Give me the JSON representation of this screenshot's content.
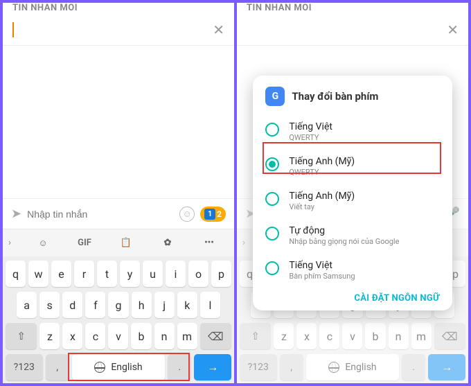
{
  "header": {
    "title": "TIN NHAN MOI"
  },
  "search": {
    "clear_glyph": "✕"
  },
  "compose": {
    "placeholder": "Nhập tin nhắn",
    "sim_number": "1",
    "sim_extra": "2"
  },
  "toolbar": {
    "arrow": "›",
    "sticker": "☺",
    "gif": "GIF",
    "clipboard": "📋",
    "settings": "✿",
    "more": "•••"
  },
  "keys": {
    "row1": [
      "q",
      "w",
      "e",
      "r",
      "t",
      "y",
      "u",
      "i",
      "o",
      "p"
    ],
    "row2": [
      "a",
      "s",
      "d",
      "f",
      "g",
      "h",
      "j",
      "k",
      "l"
    ],
    "row3": [
      "z",
      "x",
      "c",
      "v",
      "b",
      "n",
      "m"
    ],
    "shift": "⇧",
    "backspace": "⌫",
    "numswitch": "?123",
    "comma": ",",
    "period": ".",
    "enter": "→",
    "language": "English"
  },
  "popup": {
    "title": "Thay đổi bàn phím",
    "options": [
      {
        "label": "Tiếng Việt",
        "sub": "QWERTY",
        "selected": false
      },
      {
        "label": "Tiếng Anh (Mỹ)",
        "sub": "QWERTY",
        "selected": true
      },
      {
        "label": "Tiếng Anh (Mỹ)",
        "sub": "Viết tay",
        "selected": false
      },
      {
        "label": "Tự động",
        "sub": "Nhập bằng giọng nói của Google",
        "selected": false
      },
      {
        "label": "Tiếng Việt",
        "sub": "Bàn phím Samsung",
        "selected": false
      }
    ],
    "footer": "CÀI ĐẶT NGÔN NGỮ"
  }
}
